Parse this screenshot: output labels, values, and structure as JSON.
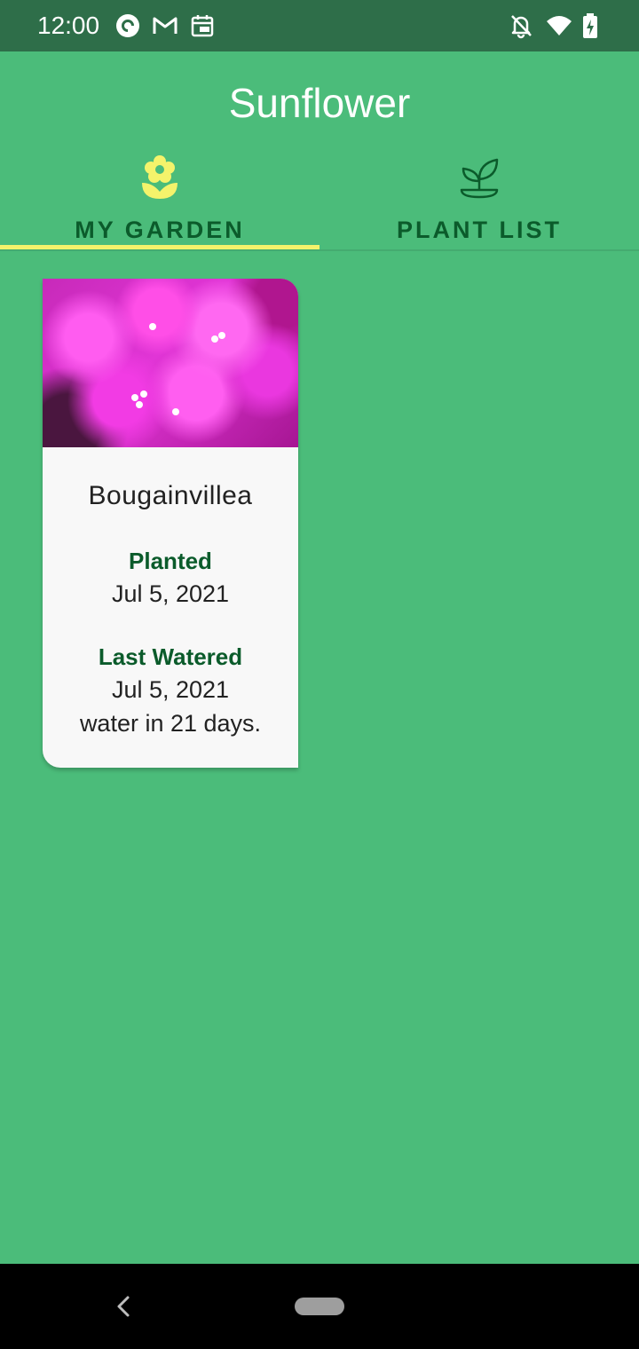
{
  "status_bar": {
    "time": "12:00",
    "left_icons": [
      "pocket-casts-icon",
      "gmail-icon",
      "calendar-icon"
    ],
    "right_icons": [
      "notifications-off-icon",
      "wifi-icon",
      "battery-charging-icon"
    ]
  },
  "app": {
    "title": "Sunflower",
    "colors": {
      "primary": "#4bbc7a",
      "status_bar": "#2e6e49",
      "tab_indicator": "#f4f36b",
      "accent_text": "#0b5b2b"
    }
  },
  "tabs": [
    {
      "label": "MY GARDEN",
      "icon": "flower-icon",
      "selected": true
    },
    {
      "label": "PLANT LIST",
      "icon": "sprout-icon",
      "selected": false
    }
  ],
  "garden": {
    "plants": [
      {
        "name": "Bougainvillea",
        "planted_label": "Planted",
        "planted_date": "Jul 5, 2021",
        "watered_label": "Last Watered",
        "watered_date": "Jul 5, 2021",
        "water_interval": "water in 21 days."
      }
    ]
  },
  "nav_bar": {
    "icons": [
      "back-icon",
      "home-pill-icon"
    ]
  }
}
